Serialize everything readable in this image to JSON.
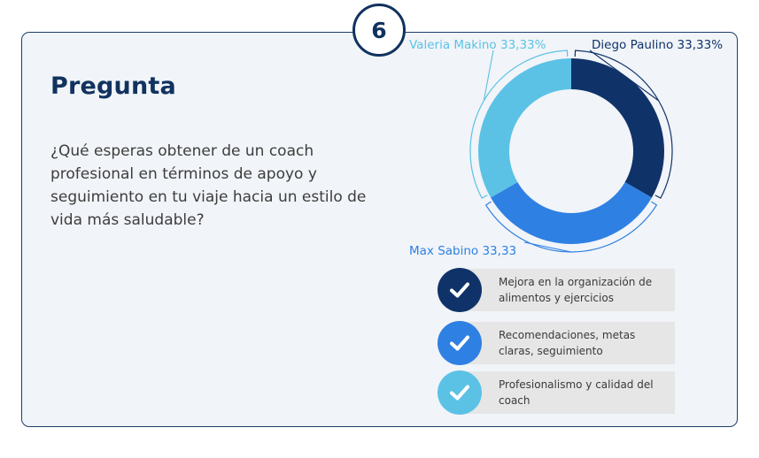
{
  "badge": {
    "number": "6"
  },
  "title": "Pregunta",
  "question": "¿Qué esperas obtener de un coach profesional en términos de apoyo y seguimiento en tu viaje hacia un estilo de vida más saludable?",
  "chart_data": {
    "type": "pie",
    "donut": true,
    "title": "",
    "series": [
      {
        "name": "Diego Paulino",
        "value": 33.33,
        "label": "Diego Paulino 33,33%",
        "color": "#0f3369"
      },
      {
        "name": "Max Sabino",
        "value": 33.33,
        "label": "Max Sabino 33,33",
        "color": "#2f80e3"
      },
      {
        "name": "Valeria Makino",
        "value": 33.33,
        "label": "Valeria Makino 33,33%",
        "color": "#5bc2e6"
      }
    ]
  },
  "legend": [
    {
      "text": "Mejora en la organización de alimentos y ejercicios",
      "color": "#0f3369",
      "icon": "check-icon"
    },
    {
      "text": "Recomendaciones, metas claras, seguimiento",
      "color": "#2f80e3",
      "icon": "check-icon"
    },
    {
      "text": "Profesionalismo y calidad del coach",
      "color": "#5bc2e6",
      "icon": "check-icon"
    }
  ]
}
